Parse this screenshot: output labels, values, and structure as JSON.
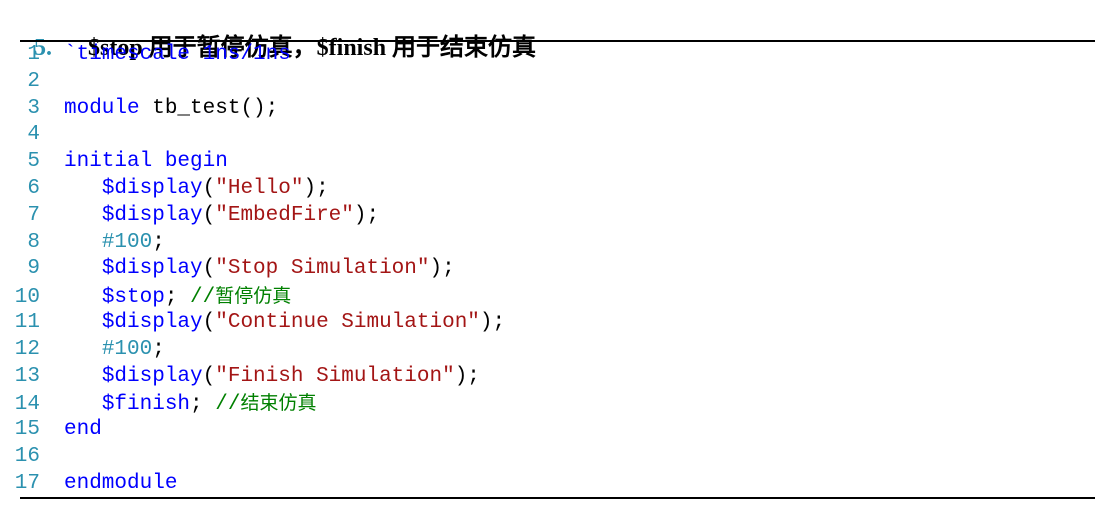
{
  "heading": {
    "number": "5.",
    "title": "$stop 用于暂停仿真，$finish 用于结束仿真"
  },
  "colors": {
    "line_number": "#2b91af",
    "keyword": "#0000ff",
    "string": "#a31515",
    "comment": "#008000",
    "number": "#2b91af",
    "plain": "#000000"
  },
  "code": {
    "language": "verilog",
    "lines": [
      {
        "n": "1",
        "indent": "",
        "tokens": [
          {
            "t": "dir",
            "v": "`timescale 1ns/1ns"
          }
        ]
      },
      {
        "n": "2",
        "indent": "",
        "tokens": []
      },
      {
        "n": "3",
        "indent": "",
        "tokens": [
          {
            "t": "kw",
            "v": "module"
          },
          {
            "t": "pl",
            "v": " tb_test();"
          }
        ]
      },
      {
        "n": "4",
        "indent": "",
        "tokens": []
      },
      {
        "n": "5",
        "indent": "",
        "tokens": [
          {
            "t": "kw",
            "v": "initial begin"
          }
        ]
      },
      {
        "n": "6",
        "indent": "   ",
        "tokens": [
          {
            "t": "sys",
            "v": "$display"
          },
          {
            "t": "pl",
            "v": "("
          },
          {
            "t": "str",
            "v": "\"Hello\""
          },
          {
            "t": "pl",
            "v": ");"
          }
        ]
      },
      {
        "n": "7",
        "indent": "   ",
        "tokens": [
          {
            "t": "sys",
            "v": "$display"
          },
          {
            "t": "pl",
            "v": "("
          },
          {
            "t": "str",
            "v": "\"EmbedFire\""
          },
          {
            "t": "pl",
            "v": ");"
          }
        ]
      },
      {
        "n": "8",
        "indent": "   ",
        "tokens": [
          {
            "t": "num",
            "v": "#100"
          },
          {
            "t": "pl",
            "v": ";"
          }
        ]
      },
      {
        "n": "9",
        "indent": "   ",
        "tokens": [
          {
            "t": "sys",
            "v": "$display"
          },
          {
            "t": "pl",
            "v": "("
          },
          {
            "t": "str",
            "v": "\"Stop Simulation\""
          },
          {
            "t": "pl",
            "v": ");"
          }
        ]
      },
      {
        "n": "10",
        "indent": "   ",
        "tokens": [
          {
            "t": "sys",
            "v": "$stop"
          },
          {
            "t": "pl",
            "v": "; "
          },
          {
            "t": "cmt",
            "v": "//暂停仿真"
          }
        ]
      },
      {
        "n": "11",
        "indent": "   ",
        "tokens": [
          {
            "t": "sys",
            "v": "$display"
          },
          {
            "t": "pl",
            "v": "("
          },
          {
            "t": "str",
            "v": "\"Continue Simulation\""
          },
          {
            "t": "pl",
            "v": ");"
          }
        ]
      },
      {
        "n": "12",
        "indent": "   ",
        "tokens": [
          {
            "t": "num",
            "v": "#100"
          },
          {
            "t": "pl",
            "v": ";"
          }
        ]
      },
      {
        "n": "13",
        "indent": "   ",
        "tokens": [
          {
            "t": "sys",
            "v": "$display"
          },
          {
            "t": "pl",
            "v": "("
          },
          {
            "t": "str",
            "v": "\"Finish Simulation\""
          },
          {
            "t": "pl",
            "v": ");"
          }
        ]
      },
      {
        "n": "14",
        "indent": "   ",
        "tokens": [
          {
            "t": "sys",
            "v": "$finish"
          },
          {
            "t": "pl",
            "v": "; "
          },
          {
            "t": "cmt",
            "v": "//结束仿真"
          }
        ]
      },
      {
        "n": "15",
        "indent": "",
        "tokens": [
          {
            "t": "kw",
            "v": "end"
          }
        ]
      },
      {
        "n": "16",
        "indent": "",
        "tokens": []
      },
      {
        "n": "17",
        "indent": "",
        "tokens": [
          {
            "t": "kw",
            "v": "endmodule"
          }
        ]
      }
    ]
  }
}
